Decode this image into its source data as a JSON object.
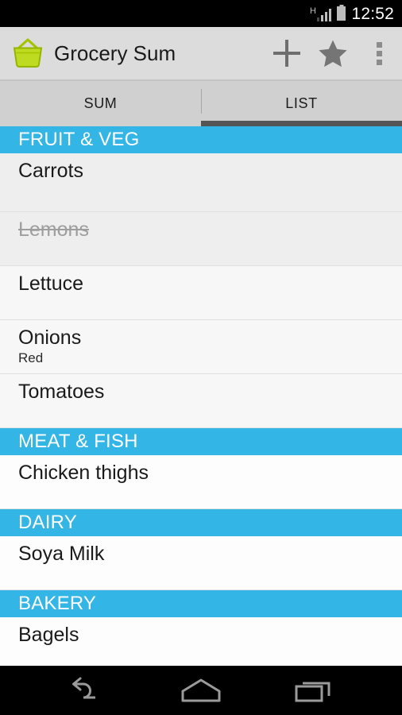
{
  "status_bar": {
    "network_type": "H",
    "clock": "12:52",
    "signal_icon": "signal-bars-icon",
    "battery_icon": "battery-icon"
  },
  "action_bar": {
    "app_icon": "shopping-basket-icon",
    "title": "Grocery Sum",
    "actions": [
      {
        "name": "add-item-button",
        "icon": "plus-icon"
      },
      {
        "name": "favorite-button",
        "icon": "star-icon"
      },
      {
        "name": "overflow-menu-button",
        "icon": "overflow-dots-icon"
      }
    ]
  },
  "tabs": [
    {
      "label": "SUM",
      "active": false
    },
    {
      "label": "LIST",
      "active": true
    }
  ],
  "list": {
    "sections": [
      {
        "header": "FRUIT & VEG",
        "items": [
          {
            "name": "Carrots",
            "sub": "",
            "done": false
          },
          {
            "name": "Lemons",
            "sub": "",
            "done": true
          },
          {
            "name": "Lettuce",
            "sub": "",
            "done": false
          },
          {
            "name": "Onions",
            "sub": "Red",
            "done": false
          },
          {
            "name": "Tomatoes",
            "sub": "",
            "done": false
          }
        ]
      },
      {
        "header": "MEAT & FISH",
        "items": [
          {
            "name": "Chicken thighs",
            "sub": "",
            "done": false
          }
        ]
      },
      {
        "header": "DAIRY",
        "items": [
          {
            "name": "Soya Milk",
            "sub": "",
            "done": false
          }
        ]
      },
      {
        "header": "BAKERY",
        "items": [
          {
            "name": "Bagels",
            "sub": "",
            "done": false
          }
        ]
      }
    ]
  },
  "nav_bar": [
    {
      "name": "nav-back-button",
      "icon": "back-arrow-icon"
    },
    {
      "name": "nav-home-button",
      "icon": "home-icon"
    },
    {
      "name": "nav-recents-button",
      "icon": "recents-icon"
    }
  ],
  "colors": {
    "section_header_bg": "#33b5e5",
    "action_bar_bg": "#dcdcdc",
    "tab_bar_bg": "#d0d0d0",
    "tab_indicator": "#555555",
    "app_icon": "#aacc00",
    "nav_icon": "#8c8c8c",
    "done_text": "#9e9e9e"
  }
}
